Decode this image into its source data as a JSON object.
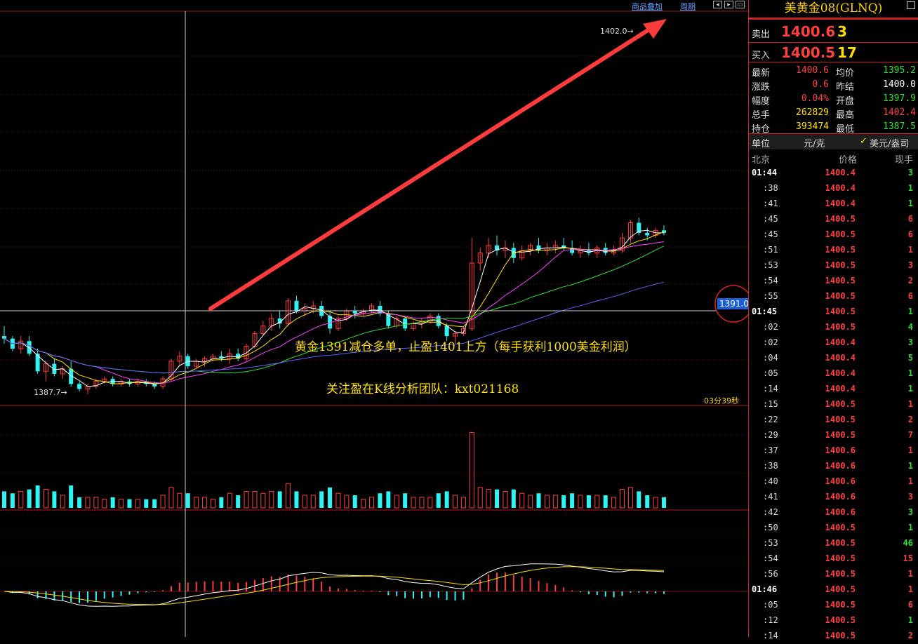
{
  "toolbar": {
    "overlay_label": "商品叠加",
    "period_label": "周期"
  },
  "symbol": {
    "title": "美黄金08(GLNQ)"
  },
  "quote": {
    "ask_label": "卖出",
    "ask_price": "1400.6",
    "ask_vol": "3",
    "bid_label": "买入",
    "bid_price": "1400.5",
    "bid_vol": "17"
  },
  "stats": [
    {
      "l1": "最新",
      "v1": "1400.6",
      "c1": "#ff4040",
      "l2": "均价",
      "v2": "1395.2",
      "c2": "#30e030"
    },
    {
      "l1": "涨跌",
      "v1": "0.6",
      "c1": "#ff4040",
      "l2": "昨结",
      "v2": "1400.0",
      "c2": "#ffffff"
    },
    {
      "l1": "幅度",
      "v1": "0.04%",
      "c1": "#ff4040",
      "l2": "开盘",
      "v2": "1397.9",
      "c2": "#30e030"
    },
    {
      "l1": "总手",
      "v1": "262829",
      "c1": "#ffe000",
      "l2": "最高",
      "v2": "1402.4",
      "c2": "#ff4040"
    },
    {
      "l1": "持仓",
      "v1": "393474",
      "c1": "#ffe000",
      "l2": "最低",
      "v2": "1387.5",
      "c2": "#30e030"
    }
  ],
  "units": {
    "label": "单位",
    "unit1": "元/克",
    "check": "✓",
    "unit2": "美元/盎司"
  },
  "ticks_header": {
    "time": "北京",
    "price": "价格",
    "vol": "现手"
  },
  "ticks": [
    {
      "t": "01:44",
      "p": "1400.4",
      "v": "3",
      "vc": "#30e030",
      "major": true
    },
    {
      "t": ":38",
      "p": "1400.4",
      "v": "1",
      "vc": "#30e030"
    },
    {
      "t": ":41",
      "p": "1400.4",
      "v": "1",
      "vc": "#30e030"
    },
    {
      "t": ":45",
      "p": "1400.5",
      "v": "6",
      "vc": "#ff4040"
    },
    {
      "t": ":45",
      "p": "1400.5",
      "v": "6",
      "vc": "#ff4040"
    },
    {
      "t": ":51",
      "p": "1400.5",
      "v": "1",
      "vc": "#ff4040"
    },
    {
      "t": ":53",
      "p": "1400.5",
      "v": "3",
      "vc": "#ff4040"
    },
    {
      "t": ":54",
      "p": "1400.5",
      "v": "2",
      "vc": "#ff4040"
    },
    {
      "t": ":55",
      "p": "1400.5",
      "v": "6",
      "vc": "#ff4040"
    },
    {
      "t": "01:45",
      "p": "1400.5",
      "v": "1",
      "vc": "#30e030",
      "major": true
    },
    {
      "t": ":02",
      "p": "1400.5",
      "v": "4",
      "vc": "#30e030"
    },
    {
      "t": ":02",
      "p": "1400.4",
      "v": "3",
      "vc": "#30e030"
    },
    {
      "t": ":04",
      "p": "1400.4",
      "v": "5",
      "vc": "#30e030"
    },
    {
      "t": ":05",
      "p": "1400.4",
      "v": "1",
      "vc": "#30e030"
    },
    {
      "t": ":14",
      "p": "1400.4",
      "v": "1",
      "vc": "#30e030"
    },
    {
      "t": ":15",
      "p": "1400.5",
      "v": "1",
      "vc": "#ff4040"
    },
    {
      "t": ":22",
      "p": "1400.5",
      "v": "2",
      "vc": "#ff4040"
    },
    {
      "t": ":29",
      "p": "1400.5",
      "v": "7",
      "vc": "#ff4040"
    },
    {
      "t": ":37",
      "p": "1400.6",
      "v": "1",
      "vc": "#ff4040"
    },
    {
      "t": ":38",
      "p": "1400.6",
      "v": "1",
      "vc": "#30e030"
    },
    {
      "t": ":40",
      "p": "1400.6",
      "v": "1",
      "vc": "#ff4040"
    },
    {
      "t": ":41",
      "p": "1400.6",
      "v": "3",
      "vc": "#ff4040"
    },
    {
      "t": ":42",
      "p": "1400.6",
      "v": "3",
      "vc": "#30e030"
    },
    {
      "t": ":50",
      "p": "1400.5",
      "v": "1",
      "vc": "#30e030"
    },
    {
      "t": ":53",
      "p": "1400.5",
      "v": "46",
      "vc": "#30e030"
    },
    {
      "t": ":54",
      "p": "1400.5",
      "v": "15",
      "vc": "#ff4040"
    },
    {
      "t": ":56",
      "p": "1400.5",
      "v": "1",
      "vc": "#ff4040"
    },
    {
      "t": "01:46",
      "p": "1400.5",
      "v": "1",
      "vc": "#ff4040",
      "major": true
    },
    {
      "t": ":05",
      "p": "1400.5",
      "v": "6",
      "vc": "#ff4040"
    },
    {
      "t": ":12",
      "p": "1400.5",
      "v": "1",
      "vc": "#30e030"
    },
    {
      "t": ":14",
      "p": "1400.5",
      "v": "2",
      "vc": "#ff4040"
    }
  ],
  "annotations": {
    "line1": "黄金1391减仓多单，止盈1401上方（每手获利1000美金利润）",
    "line2": "关注盈在K线分析团队：kxt021168",
    "high_label": "1402.0→",
    "low_label": "1387.7→",
    "cursor_price": "1391.0",
    "countdown": "03分39秒"
  },
  "chart_data": {
    "type": "candlestick",
    "ohlc": [
      [
        1389.9,
        1390.3,
        1389.6,
        1389.8
      ],
      [
        1389.8,
        1389.9,
        1389.3,
        1389.4
      ],
      [
        1389.4,
        1389.9,
        1389.2,
        1389.7
      ],
      [
        1389.7,
        1389.9,
        1389.1,
        1389.2
      ],
      [
        1389.2,
        1389.4,
        1388.4,
        1388.5
      ],
      [
        1388.5,
        1388.9,
        1388.1,
        1388.8
      ],
      [
        1388.8,
        1389.0,
        1388.3,
        1388.4
      ],
      [
        1388.4,
        1388.7,
        1388.2,
        1388.6
      ],
      [
        1388.6,
        1388.9,
        1387.9,
        1388.0
      ],
      [
        1388.0,
        1388.1,
        1387.7,
        1387.8
      ],
      [
        1387.8,
        1388.0,
        1387.6,
        1387.9
      ],
      [
        1387.9,
        1388.2,
        1387.8,
        1388.1
      ],
      [
        1388.1,
        1388.3,
        1388.0,
        1388.2
      ],
      [
        1388.2,
        1388.3,
        1387.9,
        1388.0
      ],
      [
        1388.0,
        1388.2,
        1387.9,
        1388.1
      ],
      [
        1388.1,
        1388.2,
        1387.9,
        1388.0
      ],
      [
        1388.0,
        1388.2,
        1387.9,
        1388.1
      ],
      [
        1388.1,
        1388.2,
        1387.9,
        1388.0
      ],
      [
        1388.0,
        1388.1,
        1387.8,
        1387.9
      ],
      [
        1387.9,
        1388.3,
        1387.8,
        1388.2
      ],
      [
        1388.2,
        1389.0,
        1388.1,
        1388.9
      ],
      [
        1388.9,
        1389.3,
        1388.7,
        1389.1
      ],
      [
        1389.1,
        1389.2,
        1388.6,
        1388.7
      ],
      [
        1388.7,
        1389.0,
        1388.6,
        1388.9
      ],
      [
        1388.9,
        1389.1,
        1388.7,
        1389.0
      ],
      [
        1389.0,
        1389.2,
        1388.9,
        1389.1
      ],
      [
        1389.1,
        1389.3,
        1388.9,
        1389.0
      ],
      [
        1389.0,
        1389.4,
        1388.8,
        1389.2
      ],
      [
        1389.2,
        1389.4,
        1388.9,
        1389.0
      ],
      [
        1389.0,
        1389.6,
        1388.9,
        1389.5
      ],
      [
        1389.5,
        1390.1,
        1389.4,
        1390.0
      ],
      [
        1390.0,
        1390.5,
        1389.9,
        1390.3
      ],
      [
        1390.3,
        1390.8,
        1390.1,
        1390.6
      ],
      [
        1390.6,
        1390.9,
        1390.2,
        1390.4
      ],
      [
        1390.4,
        1391.4,
        1390.3,
        1391.3
      ],
      [
        1391.3,
        1391.5,
        1390.8,
        1390.9
      ],
      [
        1390.9,
        1391.2,
        1390.7,
        1391.0
      ],
      [
        1391.0,
        1391.3,
        1390.8,
        1391.1
      ],
      [
        1391.1,
        1391.3,
        1390.6,
        1390.7
      ],
      [
        1390.7,
        1390.9,
        1390.0,
        1390.2
      ],
      [
        1390.2,
        1390.7,
        1390.1,
        1390.6
      ],
      [
        1390.6,
        1391.0,
        1390.5,
        1390.9
      ],
      [
        1390.9,
        1391.1,
        1390.6,
        1390.8
      ],
      [
        1390.8,
        1391.0,
        1390.7,
        1390.9
      ],
      [
        1390.9,
        1391.2,
        1390.8,
        1391.1
      ],
      [
        1391.1,
        1391.3,
        1390.7,
        1390.8
      ],
      [
        1390.8,
        1390.9,
        1390.2,
        1390.3
      ],
      [
        1390.3,
        1390.7,
        1390.2,
        1390.6
      ],
      [
        1390.6,
        1390.7,
        1390.1,
        1390.2
      ],
      [
        1390.2,
        1390.5,
        1390.1,
        1390.4
      ],
      [
        1390.4,
        1390.6,
        1390.2,
        1390.5
      ],
      [
        1390.5,
        1390.8,
        1390.4,
        1390.7
      ],
      [
        1390.7,
        1390.8,
        1390.2,
        1390.3
      ],
      [
        1390.3,
        1390.4,
        1389.7,
        1389.9
      ],
      [
        1389.9,
        1390.1,
        1389.6,
        1390.0
      ],
      [
        1390.0,
        1390.3,
        1389.9,
        1390.2
      ],
      [
        1390.2,
        1393.8,
        1390.1,
        1392.8
      ],
      [
        1392.8,
        1393.4,
        1392.5,
        1393.2
      ],
      [
        1393.2,
        1393.8,
        1393.0,
        1393.5
      ],
      [
        1393.5,
        1393.9,
        1393.1,
        1393.3
      ],
      [
        1393.3,
        1393.7,
        1393.0,
        1393.4
      ],
      [
        1393.4,
        1393.6,
        1392.8,
        1393.0
      ],
      [
        1393.0,
        1393.5,
        1392.9,
        1393.3
      ],
      [
        1393.3,
        1393.6,
        1393.1,
        1393.5
      ],
      [
        1393.5,
        1393.8,
        1393.2,
        1393.3
      ],
      [
        1393.3,
        1393.6,
        1393.1,
        1393.4
      ],
      [
        1393.4,
        1393.7,
        1393.2,
        1393.5
      ],
      [
        1393.5,
        1393.8,
        1393.3,
        1393.4
      ],
      [
        1393.4,
        1393.7,
        1393.1,
        1393.2
      ],
      [
        1393.2,
        1393.5,
        1393.0,
        1393.3
      ],
      [
        1393.3,
        1393.6,
        1393.1,
        1393.2
      ],
      [
        1393.2,
        1393.5,
        1393.0,
        1393.4
      ],
      [
        1393.4,
        1393.6,
        1393.1,
        1393.2
      ],
      [
        1393.2,
        1393.5,
        1393.1,
        1393.3
      ],
      [
        1393.3,
        1394.0,
        1393.2,
        1393.8
      ],
      [
        1393.8,
        1394.5,
        1393.6,
        1394.4
      ],
      [
        1394.4,
        1394.6,
        1393.9,
        1394.0
      ],
      [
        1394.0,
        1394.2,
        1393.7,
        1393.9
      ],
      [
        1393.9,
        1394.2,
        1393.8,
        1394.1
      ],
      [
        1394.1,
        1394.3,
        1393.9,
        1394.0
      ]
    ],
    "ma_lines": [
      "#ffffff",
      "#ffe000",
      "#ff40ff",
      "#30e030",
      "#6060ff"
    ],
    "ylim": [
      1387.2,
      1402.8
    ]
  }
}
